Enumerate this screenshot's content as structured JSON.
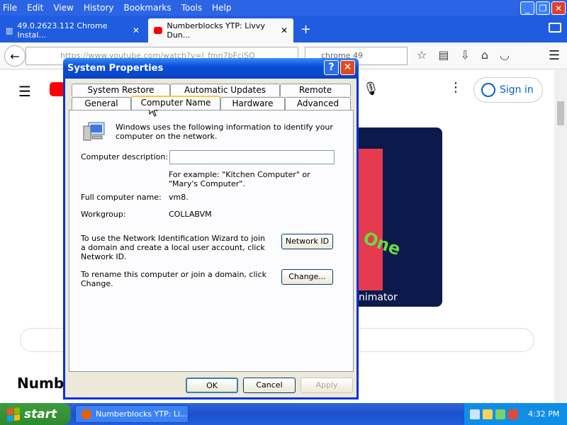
{
  "browser": {
    "menu": [
      "File",
      "Edit",
      "View",
      "History",
      "Bookmarks",
      "Tools",
      "Help"
    ],
    "tabs": [
      {
        "label": "49.0.2623.112 Chrome Instal...",
        "active": false
      },
      {
        "label": "Numberblocks YTP: Livvy Dun...",
        "active": true
      }
    ],
    "url": "https://www.youtube.com/watch?v=l_fmn7bFciSQ",
    "search": "chrome 49"
  },
  "youtube": {
    "sign_in": "Sign in",
    "video_text_one": "One",
    "video_text_animator": "nimator",
    "page_title": "Numbe"
  },
  "dialog": {
    "title": "System Properties",
    "tabs_back": [
      "System Restore",
      "Automatic Updates",
      "Remote"
    ],
    "tabs_front": [
      "General",
      "Computer Name",
      "Hardware",
      "Advanced"
    ],
    "intro": "Windows uses the following information to identify your computer on the network.",
    "description_label": "Computer description:",
    "description_value": "",
    "example": "For example: \"Kitchen Computer\" or \"Mary's Computer\".",
    "full_name_label": "Full computer name:",
    "full_name_value": "vm8.",
    "workgroup_label": "Workgroup:",
    "workgroup_value": "COLLABVM",
    "network_id_text": "To use the Network Identification Wizard to join a domain and create a local user account, click Network ID.",
    "network_id_button": "Network ID",
    "rename_text": "To rename this computer or join a domain, click Change.",
    "change_button": "Change...",
    "ok": "OK",
    "cancel": "Cancel",
    "apply": "Apply"
  },
  "taskbar": {
    "start": "start",
    "task": "Numberblocks YTP: Li...",
    "clock": "4:32 PM"
  },
  "colors": {
    "xp_blue": "#0a4fd9",
    "start_green": "#3f9b3f",
    "youtube_red": "#ff0000"
  }
}
